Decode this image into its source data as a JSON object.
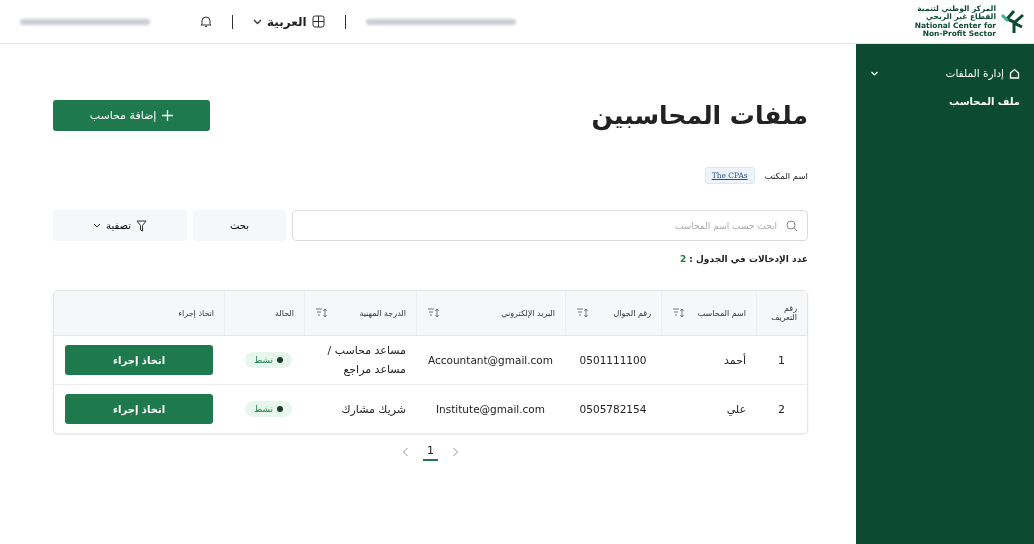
{
  "header": {
    "logo_lines": [
      "المركز الوطني لتنمية",
      "القطاع غير الربحي",
      "National Center for",
      "Non-Profit Sector"
    ],
    "language": "العربية"
  },
  "sidebar": {
    "items": [
      {
        "label": "إدارة الملفات",
        "expanded": true,
        "children": [
          {
            "label": "ملف المحاسب",
            "selected": true
          }
        ]
      }
    ]
  },
  "title": "ملفات المحاسبين",
  "add_button": "إضافة محاسب",
  "office": {
    "label": "اسم المكتب",
    "value": "The CPAs"
  },
  "search": {
    "placeholder": "ابحث حسب اسم المحاسب",
    "button": "بحث",
    "filter": "تصفية"
  },
  "entries": {
    "label": "عدد الإدخالات في الجدول :",
    "count": "2"
  },
  "table": {
    "columns": [
      {
        "label": "رقم التعريف",
        "sortable": false
      },
      {
        "label": "اسم المحاسب",
        "sortable": true
      },
      {
        "label": "رقم الجوال",
        "sortable": true
      },
      {
        "label": "البريد الإلكتروني",
        "sortable": true
      },
      {
        "label": "الدرجة المهنية",
        "sortable": true
      },
      {
        "label": "الحالة",
        "sortable": false
      },
      {
        "label": "اتخاذ إجراء",
        "sortable": false
      }
    ],
    "rows": [
      {
        "id": "1",
        "name": "أحمد",
        "mobile": "0501111100",
        "email": "Accountant@gmail.com",
        "grade": "مساعد محاسب / مساعد مراجع",
        "status": {
          "kind": "active",
          "label": "نشط"
        },
        "action": "اتخاذ إجراء"
      },
      {
        "id": "2",
        "name": "علي",
        "mobile": "0505782154",
        "email": "Institute@gmail.com",
        "grade": "شريك مشارك",
        "status": {
          "kind": "active",
          "label": "نشط"
        },
        "action": "اتخاذ إجراء"
      }
    ]
  },
  "pagination": {
    "pages": [
      {
        "label": "1",
        "selected": true
      }
    ]
  }
}
